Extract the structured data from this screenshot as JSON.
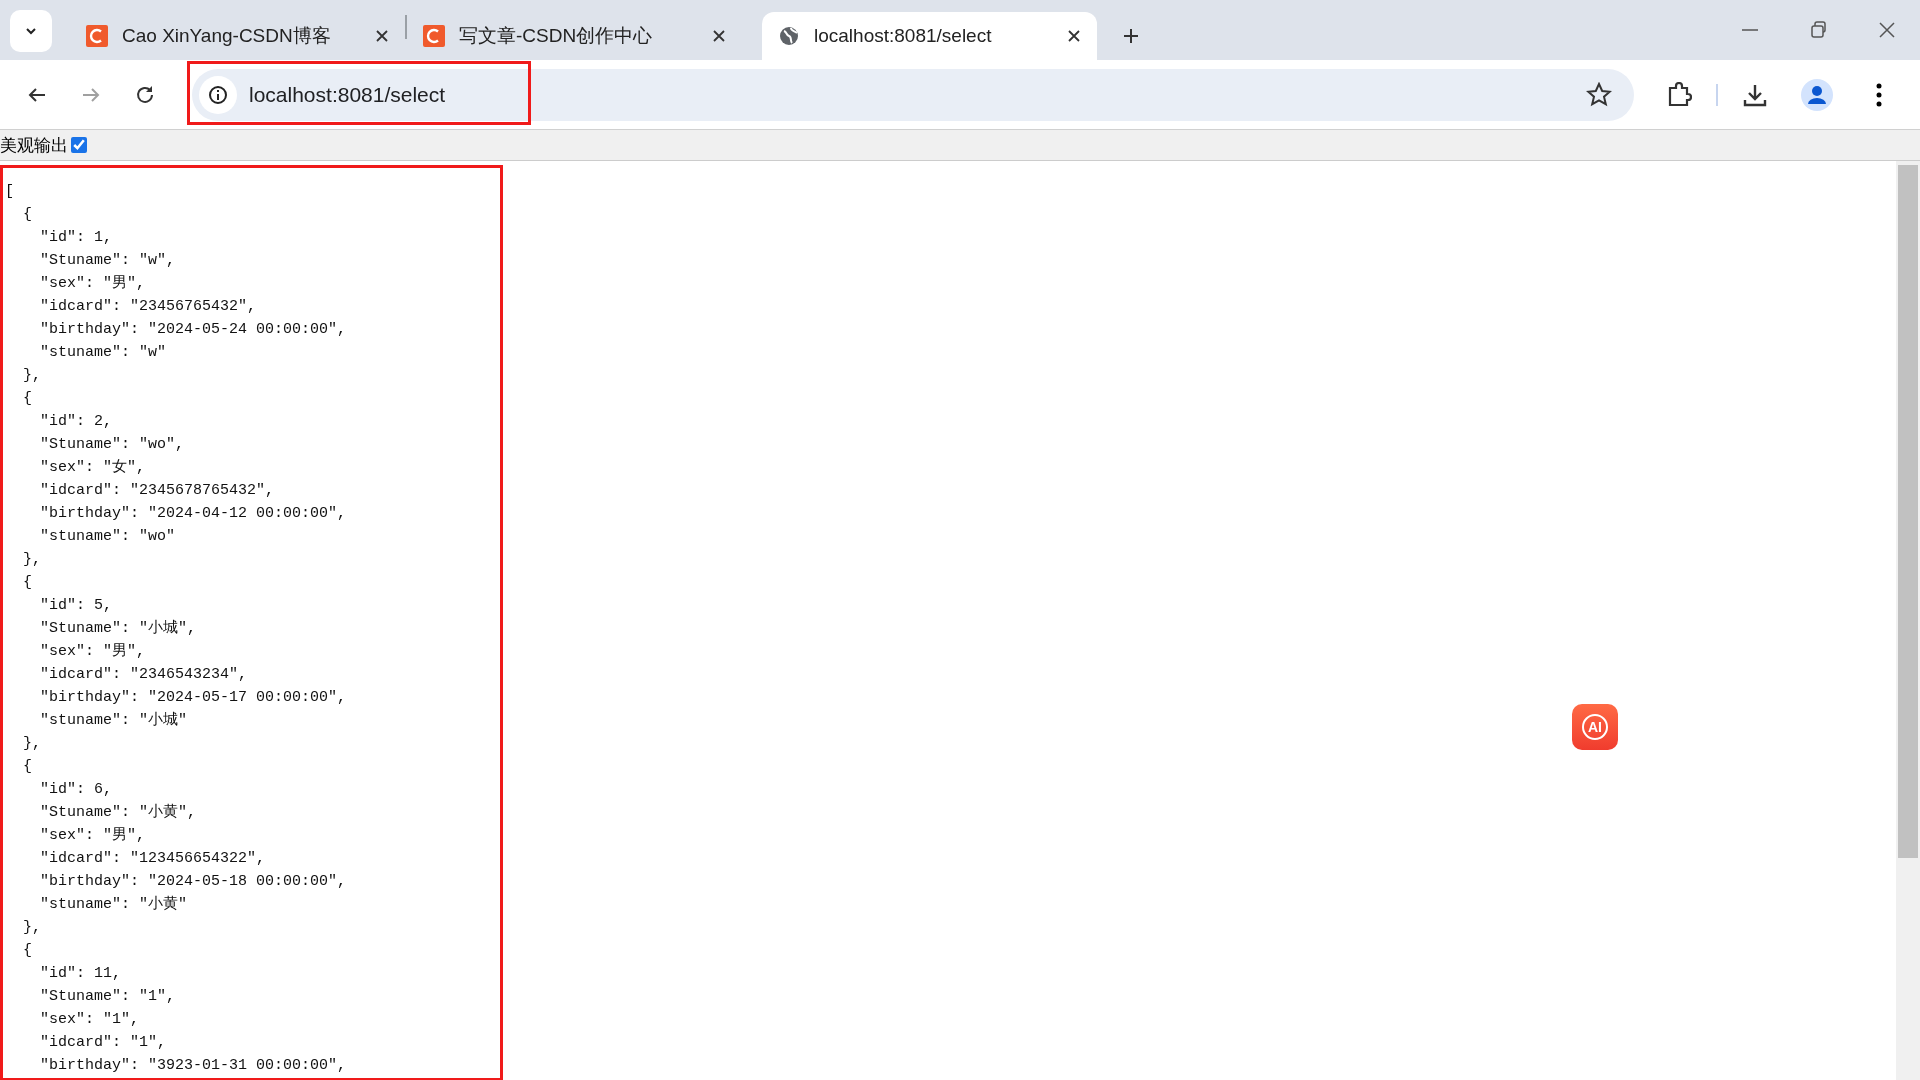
{
  "tabs": [
    {
      "title": "Cao XinYang-CSDN博客",
      "kind": "site",
      "selected": false
    },
    {
      "title": "写文章-CSDN创作中心",
      "kind": "site",
      "selected": false
    },
    {
      "title": "localhost:8081/select",
      "kind": "local",
      "selected": true
    }
  ],
  "navigation": {
    "back_disabled": false,
    "forward_disabled": true
  },
  "address_bar": {
    "url": "localhost:8081/select",
    "highlighted": true
  },
  "pretty_print": {
    "label": "美观输出",
    "checked": true
  },
  "json_output": {
    "highlighted": true,
    "open": "[",
    "objects": [
      {
        "open": "{",
        "lines": [
          "\"id\": 1,",
          "\"Stuname\": \"w\",",
          "\"sex\": \"男\",",
          "\"idcard\": \"23456765432\",",
          "\"birthday\": \"2024-05-24 00:00:00\",",
          "\"stuname\": \"w\""
        ],
        "close": "},"
      },
      {
        "open": "{",
        "lines": [
          "\"id\": 2,",
          "\"Stuname\": \"wo\",",
          "\"sex\": \"女\",",
          "\"idcard\": \"2345678765432\",",
          "\"birthday\": \"2024-04-12 00:00:00\",",
          "\"stuname\": \"wo\""
        ],
        "close": "},"
      },
      {
        "open": "{",
        "lines": [
          "\"id\": 5,",
          "\"Stuname\": \"小城\",",
          "\"sex\": \"男\",",
          "\"idcard\": \"2346543234\",",
          "\"birthday\": \"2024-05-17 00:00:00\",",
          "\"stuname\": \"小城\""
        ],
        "close": "},"
      },
      {
        "open": "{",
        "lines": [
          "\"id\": 6,",
          "\"Stuname\": \"小黄\",",
          "\"sex\": \"男\",",
          "\"idcard\": \"123456654322\",",
          "\"birthday\": \"2024-05-18 00:00:00\",",
          "\"stuname\": \"小黄\""
        ],
        "close": "},"
      },
      {
        "open": "{",
        "lines": [
          "\"id\": 11,",
          "\"Stuname\": \"1\",",
          "\"sex\": \"1\",",
          "\"idcard\": \"1\",",
          "\"birthday\": \"3923-01-31 00:00:00\","
        ]
      }
    ]
  },
  "floating_button": {
    "label": "AI"
  }
}
